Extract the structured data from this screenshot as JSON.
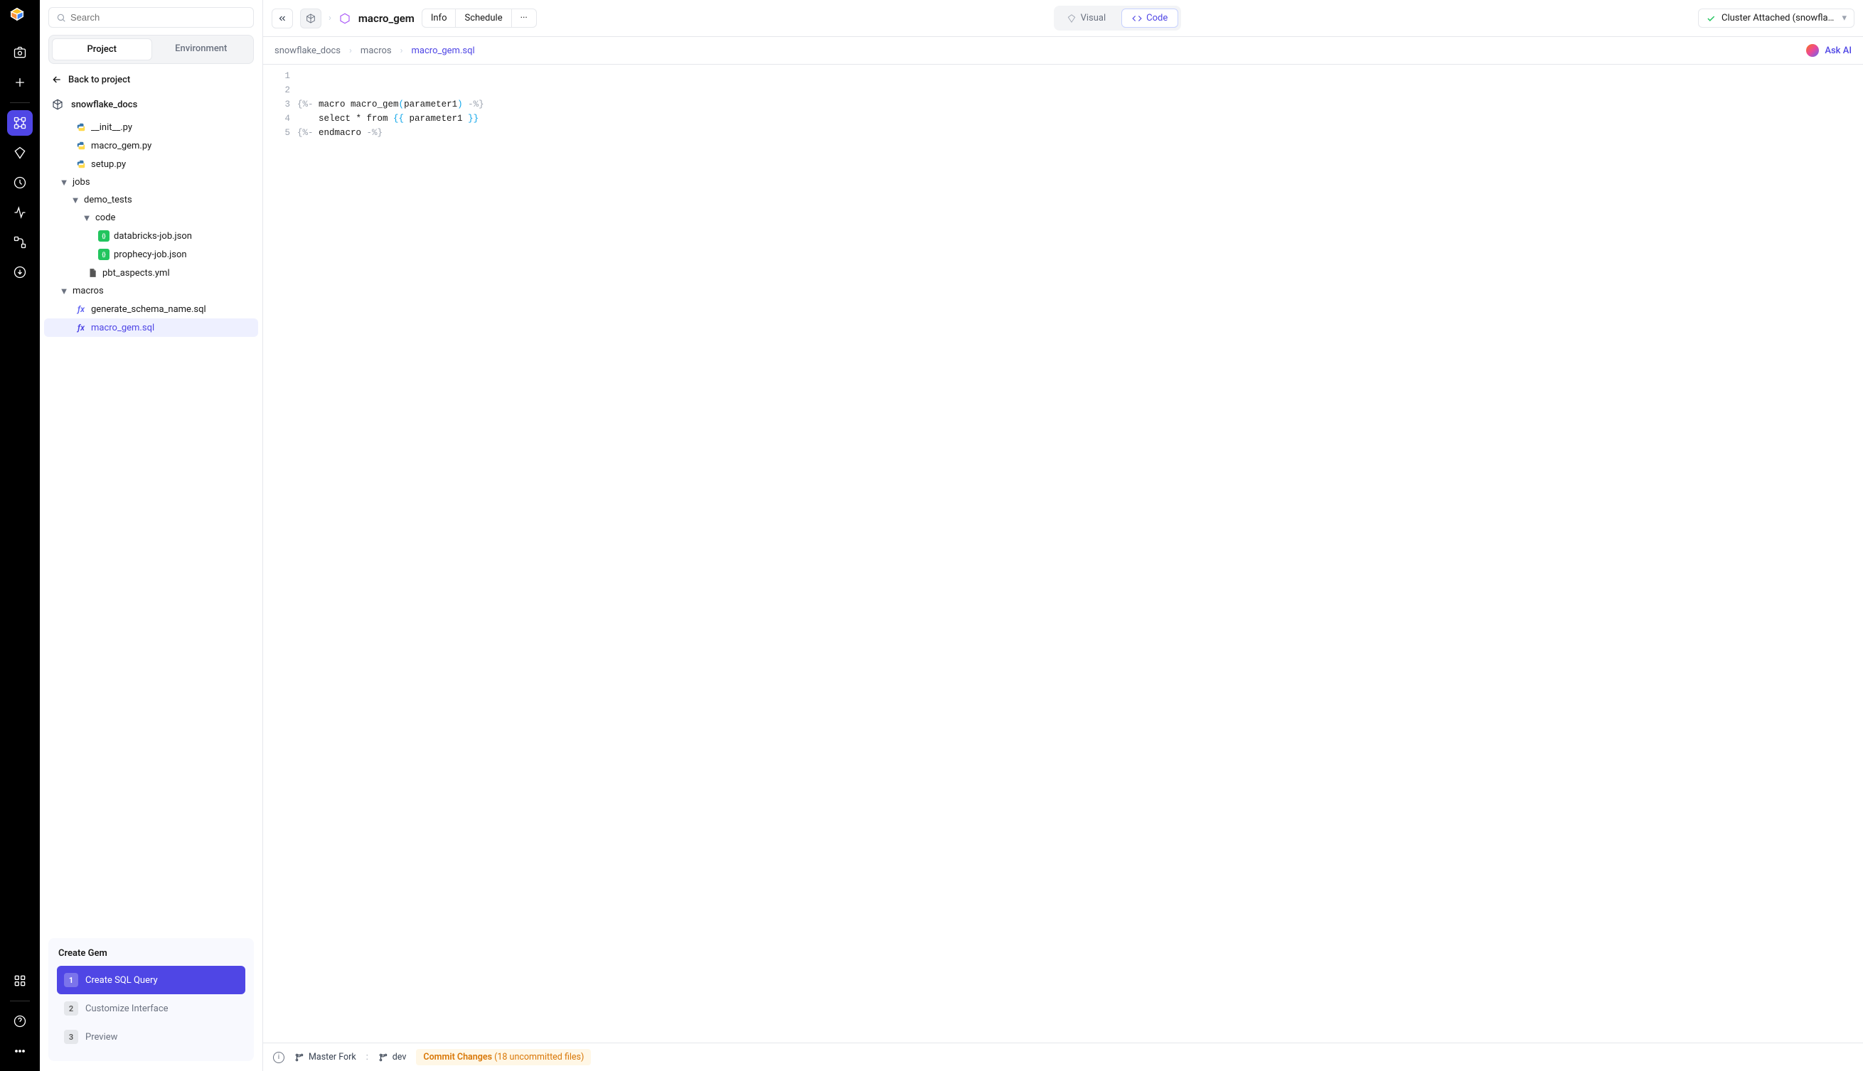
{
  "search": {
    "placeholder": "Search"
  },
  "tabs": {
    "project": "Project",
    "environment": "Environment"
  },
  "back": "Back to project",
  "project_name": "snowflake_docs",
  "tree": {
    "init_py": "__init__.py",
    "macro_gem_py": "macro_gem.py",
    "setup_py": "setup.py",
    "jobs": "jobs",
    "demo_tests": "demo_tests",
    "code": "code",
    "databricks_json": "databricks-job.json",
    "prophecy_json": "prophecy-job.json",
    "pbt_aspects": "pbt_aspects.yml",
    "macros": "macros",
    "generate_schema": "generate_schema_name.sql",
    "macro_gem_sql": "macro_gem.sql"
  },
  "gem": {
    "title": "Create Gem",
    "steps": [
      "Create SQL Query",
      "Customize Interface",
      "Preview"
    ]
  },
  "topbar": {
    "entity_name": "macro_gem",
    "info": "Info",
    "schedule": "Schedule",
    "visual": "Visual",
    "code": "Code",
    "cluster": "Cluster Attached (snowflake_..."
  },
  "crumbs": [
    "snowflake_docs",
    "macros",
    "macro_gem.sql"
  ],
  "ask_ai": "Ask AI",
  "editor": {
    "lines": [
      "1",
      "2",
      "3",
      "4",
      "5"
    ],
    "l2a": "{%-",
    "l2b": " macro macro_gem",
    "l2c": "(",
    "l2d": "parameter1",
    "l2e": ")",
    "l2f": " -%}",
    "l3a": "    select * from ",
    "l3b": "{{",
    "l3c": " parameter1 ",
    "l3d": "}}",
    "l4a": "{%-",
    "l4b": " endmacro ",
    "l4c": "-%}"
  },
  "status": {
    "master": "Master Fork",
    "colon": ":",
    "dev": "dev",
    "commit": "Commit Changes",
    "commit_detail": "(18 uncommitted files)"
  }
}
